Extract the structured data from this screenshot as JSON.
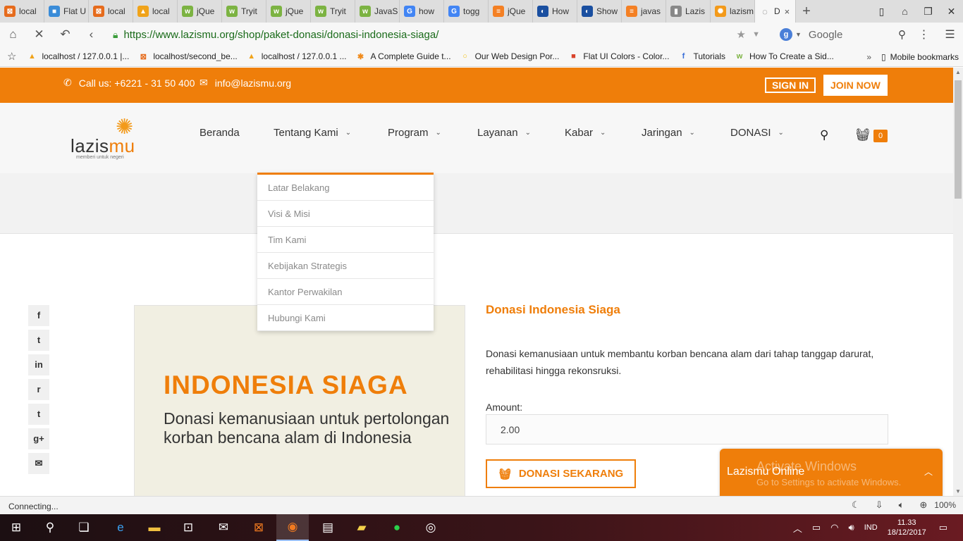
{
  "browser": {
    "tabs": [
      {
        "label": "local",
        "color": "#e66b1c",
        "glyph": "⊠"
      },
      {
        "label": "Flat U",
        "color": "#3a8cd8",
        "glyph": "■"
      },
      {
        "label": "local",
        "color": "#e66b1c",
        "glyph": "⊠"
      },
      {
        "label": "local",
        "color": "#f0a31a",
        "glyph": "▲"
      },
      {
        "label": "jQue",
        "color": "#7cb342",
        "glyph": "w"
      },
      {
        "label": "Tryit",
        "color": "#7cb342",
        "glyph": "w"
      },
      {
        "label": "jQue",
        "color": "#7cb342",
        "glyph": "w"
      },
      {
        "label": "Tryit",
        "color": "#7cb342",
        "glyph": "w"
      },
      {
        "label": "JavaS",
        "color": "#7cb342",
        "glyph": "w"
      },
      {
        "label": "how",
        "color": "#4285f4",
        "glyph": "G"
      },
      {
        "label": "togg",
        "color": "#4285f4",
        "glyph": "G"
      },
      {
        "label": "jQue",
        "color": "#f48024",
        "glyph": "≡"
      },
      {
        "label": "How",
        "color": "#1a4fa0",
        "glyph": "◐"
      },
      {
        "label": "Show",
        "color": "#1a4fa0",
        "glyph": "◐"
      },
      {
        "label": "javas",
        "color": "#f48024",
        "glyph": "≡"
      },
      {
        "label": "Lazis",
        "color": "#888888",
        "glyph": "▮"
      },
      {
        "label": "lazism",
        "color": "#f39a1a",
        "glyph": "✺"
      }
    ],
    "active_tab": {
      "label": "D",
      "close": "×"
    },
    "new_tab": "+",
    "url": "https://www.lazismu.org/shop/paket-donasi/donasi-indonesia-siaga/",
    "search_placeholder": "Google",
    "search_engine_letter": "g",
    "bookmarks": [
      {
        "label": "localhost / 127.0.0.1 |...",
        "glyph": "▲",
        "color": "#f0a31a"
      },
      {
        "label": "localhost/second_be...",
        "glyph": "⊠",
        "color": "#e66b1c"
      },
      {
        "label": "localhost / 127.0.0.1 ...",
        "glyph": "▲",
        "color": "#f0a31a"
      },
      {
        "label": "A Complete Guide t...",
        "glyph": "✱",
        "color": "#f08a1a"
      },
      {
        "label": "Our Web Design Por...",
        "glyph": "○",
        "color": "#f3c31a"
      },
      {
        "label": "Flat UI Colors - Color...",
        "glyph": "■",
        "color": "#d9442c"
      },
      {
        "label": "Tutorials",
        "glyph": "f",
        "color": "#3a6fd8"
      },
      {
        "label": "How To Create a Sid...",
        "glyph": "w",
        "color": "#7cb342"
      }
    ],
    "bookmarks_more": "»",
    "mobile_bookmarks": "Mobile bookmarks",
    "status_text": "Connecting...",
    "zoom": "100%"
  },
  "site": {
    "phone": "Call us: +6221 - 31 50 400",
    "email": "info@lazismu.org",
    "signin": "SIGN IN",
    "joinnow": "JOIN NOW",
    "logo_word_a": "lazis",
    "logo_word_b": "mu",
    "logo_tagline": "memberi untuk negeri",
    "menu": [
      {
        "label": "Beranda",
        "dropdown": false
      },
      {
        "label": "Tentang Kami",
        "dropdown": true
      },
      {
        "label": "Program",
        "dropdown": true
      },
      {
        "label": "Layanan",
        "dropdown": true
      },
      {
        "label": "Kabar",
        "dropdown": true
      },
      {
        "label": "Jaringan",
        "dropdown": true
      },
      {
        "label": "DONASI",
        "dropdown": true
      }
    ],
    "cart_count": "0",
    "dropdown": [
      "Latar Belakang",
      "Visi & Misi",
      "Tim Kami",
      "Kebijakan Strategis",
      "Kantor Perwakilan",
      "Hubungi Kami"
    ],
    "share": [
      "f",
      "t",
      "in",
      "r",
      "t",
      "g+",
      "✉"
    ]
  },
  "product": {
    "image_title": "INDONESIA SIAGA",
    "image_subtitle": "Donasi kemanusiaan untuk pertolongan korban bencana alam di Indonesia",
    "title": "Donasi Indonesia Siaga",
    "description": "Donasi kemanusiaan untuk membantu korban bencana alam dari tahap tanggap darurat, rehabilitasi hingga rekonsruksi.",
    "amount_label": "Amount:",
    "amount_value": "2.00",
    "donate_button": "DONASI SEKARANG"
  },
  "chat": {
    "title": "Lazismu Online",
    "watermark_title": "Activate Windows",
    "watermark_sub": "Go to Settings to activate Windows."
  },
  "taskbar": {
    "lang": "IND",
    "time": "11.33",
    "date": "18/12/2017"
  }
}
